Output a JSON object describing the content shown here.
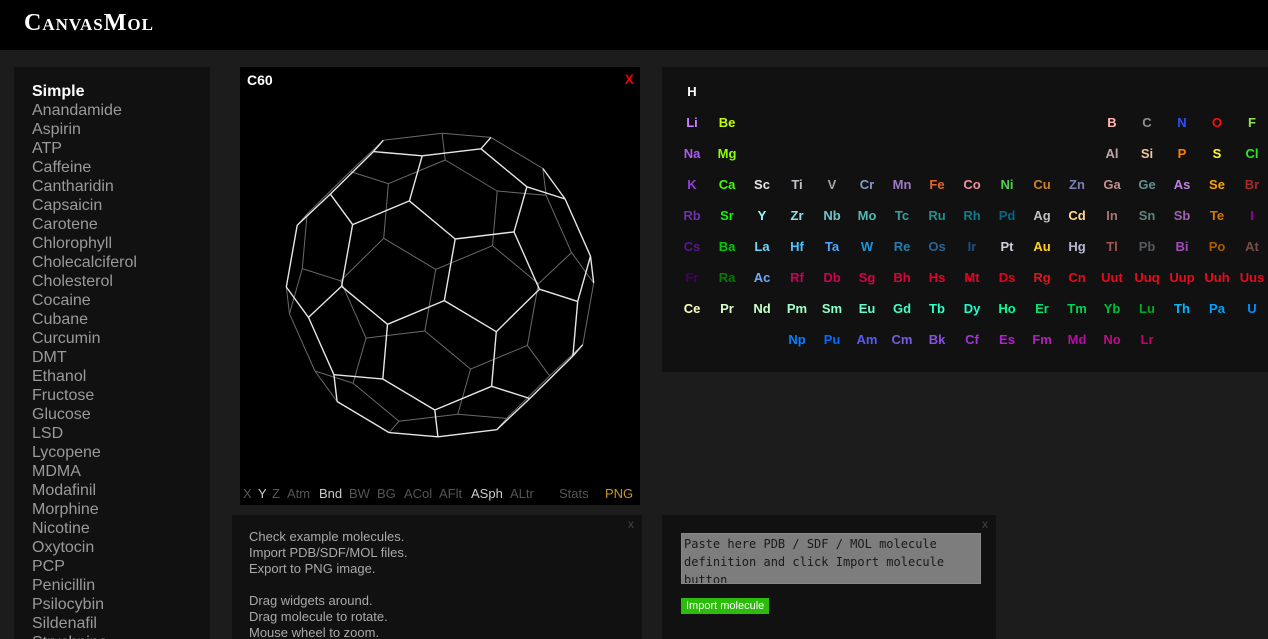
{
  "app": {
    "title": "CanvasMol"
  },
  "molecule_list": {
    "items": [
      "Simple",
      "Anandamide",
      "Aspirin",
      "ATP",
      "Caffeine",
      "Cantharidin",
      "Capsaicin",
      "Carotene",
      "Chlorophyll",
      "Cholecalciferol",
      "Cholesterol",
      "Cocaine",
      "Cubane",
      "Curcumin",
      "DMT",
      "Ethanol",
      "Fructose",
      "Glucose",
      "LSD",
      "Lycopene",
      "MDMA",
      "Modafinil",
      "Morphine",
      "Nicotine",
      "Oxytocin",
      "PCP",
      "Penicillin",
      "Psilocybin",
      "Sildenafil",
      "Strychnine"
    ],
    "active_index": 0
  },
  "viewer": {
    "title": "C60",
    "close_label": "X",
    "toolbar": [
      {
        "label": "X",
        "on": false
      },
      {
        "label": "Y",
        "on": true
      },
      {
        "label": "Z",
        "on": false
      },
      {
        "label": "Atm",
        "on": false
      },
      {
        "label": "Bnd",
        "on": true
      },
      {
        "label": "BW",
        "on": false
      },
      {
        "label": "BG",
        "on": false
      },
      {
        "label": "ACol",
        "on": false
      },
      {
        "label": "AFlt",
        "on": false
      },
      {
        "label": "ASph",
        "on": true
      },
      {
        "label": "ALtr",
        "on": false
      },
      {
        "label": "Stats",
        "on": false
      },
      {
        "label": "PNG",
        "on": true
      }
    ],
    "colors": {
      "bond_front": "#e6e6e6",
      "bond_back": "#6a6a6a"
    }
  },
  "info": {
    "close_label": "x",
    "lines": [
      "Check example molecules.",
      "Import PDB/SDF/MOL files.",
      "Export to PNG image.",
      "",
      "Drag widgets around.",
      "Drag molecule to rotate.",
      "Mouse wheel to zoom."
    ]
  },
  "periodic_table": {
    "elements": [
      {
        "symbol": "H",
        "color": "#ffffff"
      },
      {
        "symbol": "Li",
        "color": "#cc80ff"
      },
      {
        "symbol": "Be",
        "color": "#c2ff00"
      },
      {
        "symbol": "B",
        "color": "#ffb5b5"
      },
      {
        "symbol": "C",
        "color": "#909090"
      },
      {
        "symbol": "N",
        "color": "#3050f8"
      },
      {
        "symbol": "O",
        "color": "#ff0d0d"
      },
      {
        "symbol": "F",
        "color": "#90e050"
      },
      {
        "symbol": "Na",
        "color": "#ab5cf2"
      },
      {
        "symbol": "Mg",
        "color": "#8aff00"
      },
      {
        "symbol": "Al",
        "color": "#bfa6a6"
      },
      {
        "symbol": "Si",
        "color": "#f0c8a0"
      },
      {
        "symbol": "P",
        "color": "#ff8000"
      },
      {
        "symbol": "S",
        "color": "#ffff30"
      },
      {
        "symbol": "Cl",
        "color": "#1ff01f"
      },
      {
        "symbol": "K",
        "color": "#8f40d4"
      },
      {
        "symbol": "Ca",
        "color": "#3dff00"
      },
      {
        "symbol": "Sc",
        "color": "#e6e6e6"
      },
      {
        "symbol": "Ti",
        "color": "#bfc2c7"
      },
      {
        "symbol": "V",
        "color": "#a6a6ab"
      },
      {
        "symbol": "Cr",
        "color": "#8a99c7"
      },
      {
        "symbol": "Mn",
        "color": "#9c7ac7"
      },
      {
        "symbol": "Fe",
        "color": "#e06633"
      },
      {
        "symbol": "Co",
        "color": "#f090a0"
      },
      {
        "symbol": "Ni",
        "color": "#50d050"
      },
      {
        "symbol": "Cu",
        "color": "#c88033"
      },
      {
        "symbol": "Zn",
        "color": "#7d80b0"
      },
      {
        "symbol": "Ga",
        "color": "#c28f8f"
      },
      {
        "symbol": "Ge",
        "color": "#668f8f"
      },
      {
        "symbol": "As",
        "color": "#bd80e3"
      },
      {
        "symbol": "Se",
        "color": "#ffa100"
      },
      {
        "symbol": "Br",
        "color": "#a62929"
      },
      {
        "symbol": "Rb",
        "color": "#702eb0"
      },
      {
        "symbol": "Sr",
        "color": "#00ff00"
      },
      {
        "symbol": "Y",
        "color": "#94ffff"
      },
      {
        "symbol": "Zr",
        "color": "#94e0e0"
      },
      {
        "symbol": "Nb",
        "color": "#73c2c9"
      },
      {
        "symbol": "Mo",
        "color": "#54b5b5"
      },
      {
        "symbol": "Tc",
        "color": "#3b9e9e"
      },
      {
        "symbol": "Ru",
        "color": "#248f8f"
      },
      {
        "symbol": "Rh",
        "color": "#0a7d8c"
      },
      {
        "symbol": "Pd",
        "color": "#006985"
      },
      {
        "symbol": "Ag",
        "color": "#c0c0c0"
      },
      {
        "symbol": "Cd",
        "color": "#ffd98f"
      },
      {
        "symbol": "In",
        "color": "#a67573"
      },
      {
        "symbol": "Sn",
        "color": "#668080"
      },
      {
        "symbol": "Sb",
        "color": "#9e63b5"
      },
      {
        "symbol": "Te",
        "color": "#d47a00"
      },
      {
        "symbol": "I",
        "color": "#940094"
      },
      {
        "symbol": "Cs",
        "color": "#57178f"
      },
      {
        "symbol": "Ba",
        "color": "#00c900"
      },
      {
        "symbol": "La",
        "color": "#70d4ff"
      },
      {
        "symbol": "Hf",
        "color": "#4dc2ff"
      },
      {
        "symbol": "Ta",
        "color": "#4da6ff"
      },
      {
        "symbol": "W",
        "color": "#2194d6"
      },
      {
        "symbol": "Re",
        "color": "#267dab"
      },
      {
        "symbol": "Os",
        "color": "#266696"
      },
      {
        "symbol": "Ir",
        "color": "#175487"
      },
      {
        "symbol": "Pt",
        "color": "#d0d0e0"
      },
      {
        "symbol": "Au",
        "color": "#ffd123"
      },
      {
        "symbol": "Hg",
        "color": "#b8b8d0"
      },
      {
        "symbol": "Tl",
        "color": "#a6544d"
      },
      {
        "symbol": "Pb",
        "color": "#575961"
      },
      {
        "symbol": "Bi",
        "color": "#9e4fb5"
      },
      {
        "symbol": "Po",
        "color": "#ab5c00"
      },
      {
        "symbol": "At",
        "color": "#754f45"
      },
      {
        "symbol": "Fr",
        "color": "#420066"
      },
      {
        "symbol": "Ra",
        "color": "#007d00"
      },
      {
        "symbol": "Ac",
        "color": "#70abfa"
      },
      {
        "symbol": "Rf",
        "color": "#cc0059"
      },
      {
        "symbol": "Db",
        "color": "#d1004f"
      },
      {
        "symbol": "Sg",
        "color": "#d90045"
      },
      {
        "symbol": "Bh",
        "color": "#e00038"
      },
      {
        "symbol": "Hs",
        "color": "#e6002e"
      },
      {
        "symbol": "Mt",
        "color": "#eb0026"
      },
      {
        "symbol": "Ds",
        "color": "#e8001a"
      },
      {
        "symbol": "Rg",
        "color": "#e81020"
      },
      {
        "symbol": "Cn",
        "color": "#ea0a18"
      },
      {
        "symbol": "Uut",
        "color": "#ea0a1c"
      },
      {
        "symbol": "Uuq",
        "color": "#ea0a1c"
      },
      {
        "symbol": "Uup",
        "color": "#ea0a1c"
      },
      {
        "symbol": "Uuh",
        "color": "#ea0a1c"
      },
      {
        "symbol": "Uus",
        "color": "#ea0a1c"
      },
      {
        "symbol": "Ce",
        "color": "#ffffc7"
      },
      {
        "symbol": "Pr",
        "color": "#d9ffc7"
      },
      {
        "symbol": "Nd",
        "color": "#c7ffc7"
      },
      {
        "symbol": "Pm",
        "color": "#a3ffc7"
      },
      {
        "symbol": "Sm",
        "color": "#8fffc7"
      },
      {
        "symbol": "Eu",
        "color": "#61ffc7"
      },
      {
        "symbol": "Gd",
        "color": "#45ffc7"
      },
      {
        "symbol": "Tb",
        "color": "#30ffc7"
      },
      {
        "symbol": "Dy",
        "color": "#1fffc7"
      },
      {
        "symbol": "Ho",
        "color": "#00ff9c"
      },
      {
        "symbol": "Er",
        "color": "#00e675"
      },
      {
        "symbol": "Tm",
        "color": "#00d452"
      },
      {
        "symbol": "Yb",
        "color": "#00bf38"
      },
      {
        "symbol": "Lu",
        "color": "#00ab24"
      },
      {
        "symbol": "Th",
        "color": "#00baff"
      },
      {
        "symbol": "Pa",
        "color": "#00a1ff"
      },
      {
        "symbol": "U",
        "color": "#008fff"
      },
      {
        "symbol": "Np",
        "color": "#0080ff"
      },
      {
        "symbol": "Pu",
        "color": "#006bff"
      },
      {
        "symbol": "Am",
        "color": "#545cf2"
      },
      {
        "symbol": "Cm",
        "color": "#785ce3"
      },
      {
        "symbol": "Bk",
        "color": "#8a4fe3"
      },
      {
        "symbol": "Cf",
        "color": "#a136d4"
      },
      {
        "symbol": "Es",
        "color": "#b31fd4"
      },
      {
        "symbol": "Fm",
        "color": "#b31fba"
      },
      {
        "symbol": "Md",
        "color": "#b30da6"
      },
      {
        "symbol": "No",
        "color": "#bd0d87"
      },
      {
        "symbol": "Lr",
        "color": "#c70066"
      }
    ]
  },
  "import": {
    "close_label": "x",
    "placeholder": "Paste here PDB / SDF / MOL molecule definition and click Import molecule button",
    "button_label": "Import molecule"
  }
}
